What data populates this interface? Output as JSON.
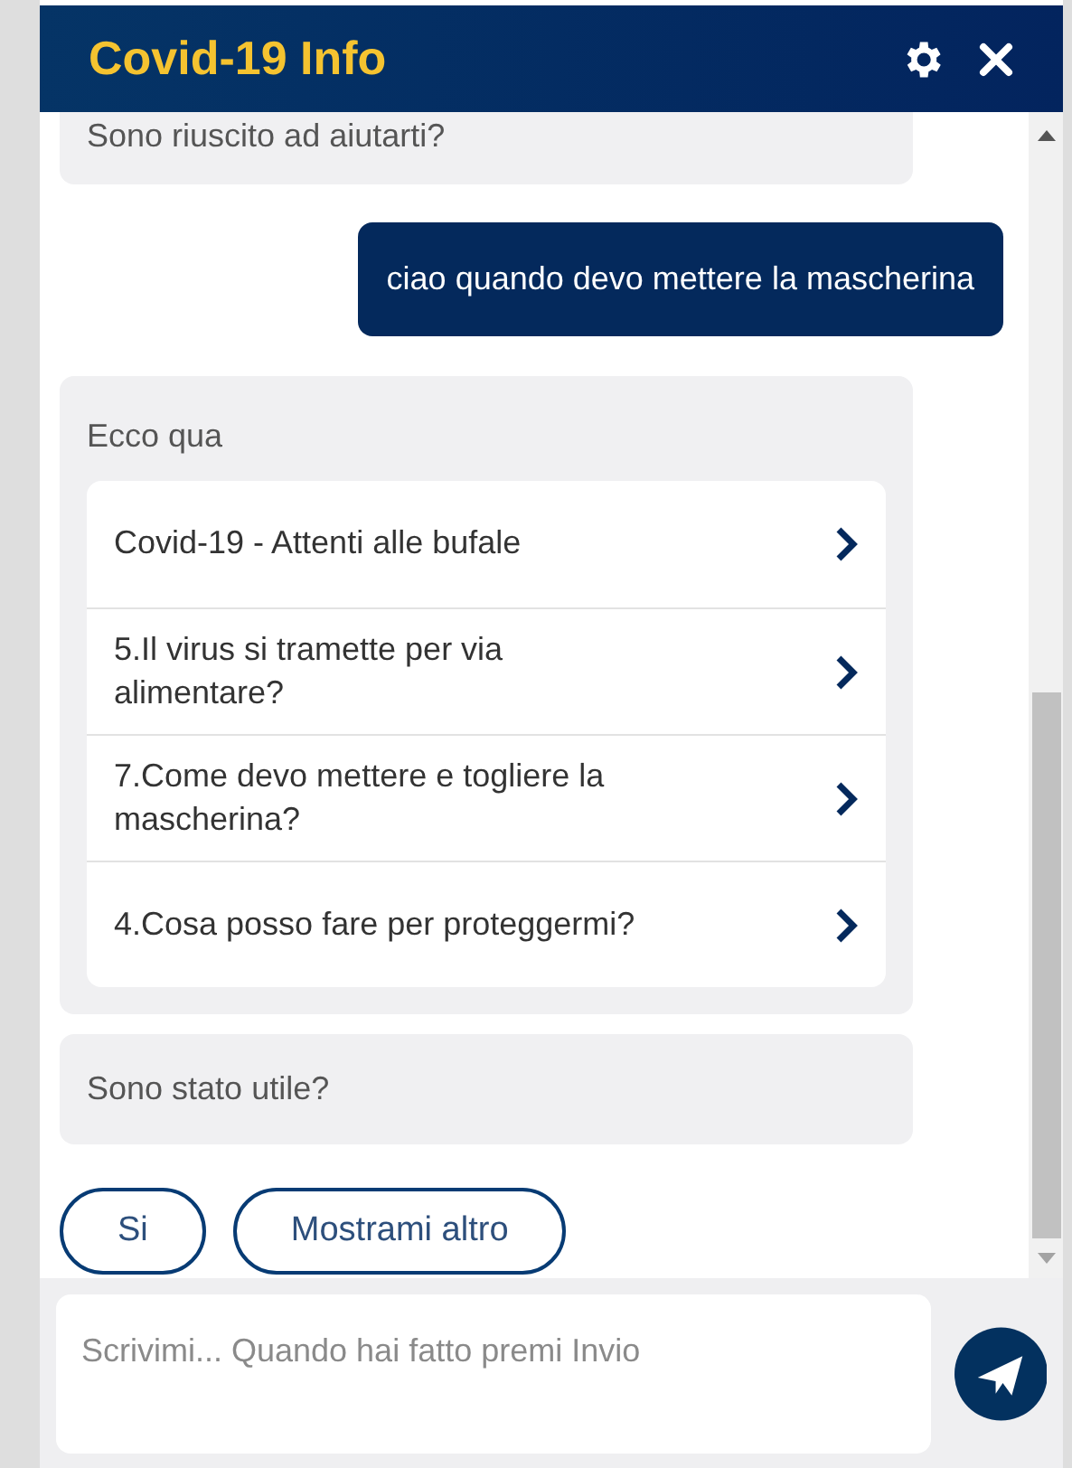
{
  "header": {
    "title": "Covid-19 Info"
  },
  "messages": [
    {
      "kind": "bot",
      "text": "Sono riuscito ad aiutarti?"
    },
    {
      "kind": "user",
      "text": "ciao quando devo mettere la mascherina"
    },
    {
      "kind": "links",
      "text": "Ecco qua",
      "links": [
        "Covid-19 - Attenti alle bufale",
        "5.Il virus si tramette per via alimentare?",
        "7.Come devo mettere e togliere la mascherina?",
        "4.Cosa posso fare per proteggermi?"
      ]
    },
    {
      "kind": "bot",
      "text": "Sono stato utile?"
    }
  ],
  "quick_replies": [
    "Si",
    "Mostrami altro"
  ],
  "composer": {
    "placeholder": "Scrivimi... Quando hai fatto premi Invio"
  }
}
